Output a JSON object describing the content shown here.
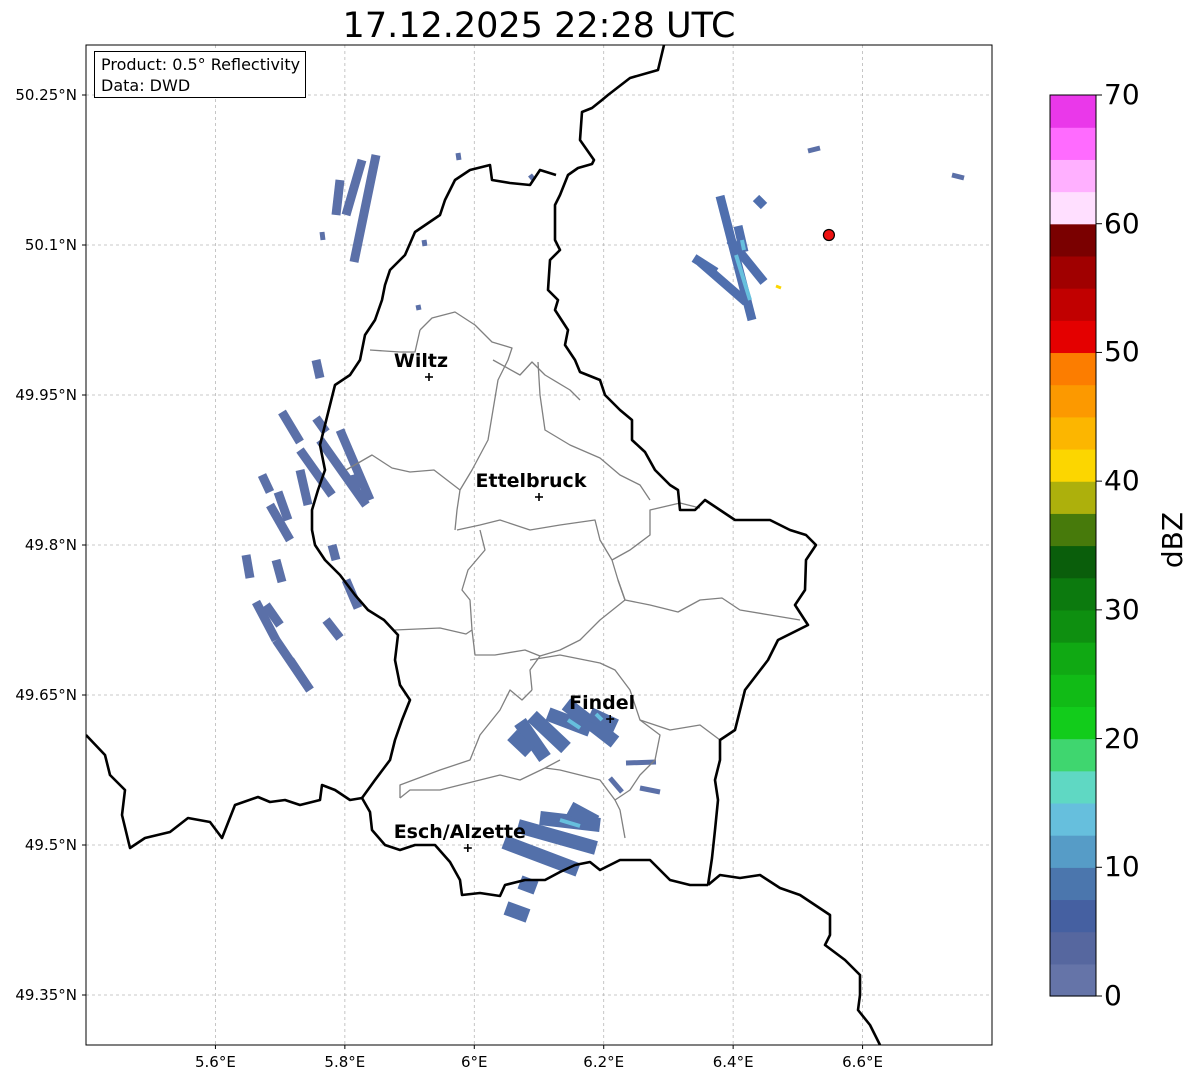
{
  "title": "17.12.2025 22:28 UTC",
  "info": {
    "product": "Product: 0.5° Reflectivity",
    "data": "Data: DWD"
  },
  "lat_labels": [
    "50.25°N",
    "50.1°N",
    "49.95°N",
    "49.8°N",
    "49.65°N",
    "49.5°N",
    "49.35°N"
  ],
  "lon_labels": [
    "5.6°E",
    "5.8°E",
    "6°E",
    "6.2°E",
    "6.4°E",
    "6.6°E"
  ],
  "lat_values": [
    50.25,
    50.1,
    49.95,
    49.8,
    49.65,
    49.5,
    49.35
  ],
  "lon_values": [
    5.6,
    5.8,
    6.0,
    6.2,
    6.4,
    6.6
  ],
  "extent": {
    "lon_min": 5.4,
    "lon_max": 6.8,
    "lat_min": 49.3,
    "lat_max": 50.3
  },
  "cities": [
    {
      "name": "Wiltz",
      "lon": 5.93,
      "lat": 49.968
    },
    {
      "name": "Ettelbruck",
      "lon": 6.1,
      "lat": 49.848
    },
    {
      "name": "Findel",
      "lon": 6.21,
      "lat": 49.626
    },
    {
      "name": "Esch/Alzette",
      "lon": 5.99,
      "lat": 49.497
    }
  ],
  "radar_site": {
    "lon": 6.548,
    "lat": 50.11,
    "color": "#ee1111"
  },
  "colorbar": {
    "label": "dBZ",
    "min": 0,
    "max": 70,
    "step": 2.5,
    "tick_labels": [
      "0",
      "10",
      "20",
      "30",
      "40",
      "50",
      "60",
      "70"
    ],
    "colors": [
      "#6574a8",
      "#56679f",
      "#4560a1",
      "#4b76ad",
      "#569cc7",
      "#66bfdd",
      "#5fd8c3",
      "#3fd66f",
      "#12cc1b",
      "#11bb16",
      "#10a913",
      "#0e8f10",
      "#0c7a0e",
      "#0a5e0b",
      "#477a0b",
      "#adb00c",
      "#fcd600",
      "#fcb600",
      "#fc9900",
      "#fc7d00",
      "#e40000",
      "#c10000",
      "#a00000",
      "#7a0000",
      "#ffdfff",
      "#ffb0ff",
      "#ff6bff",
      "#ea38ea"
    ]
  }
}
